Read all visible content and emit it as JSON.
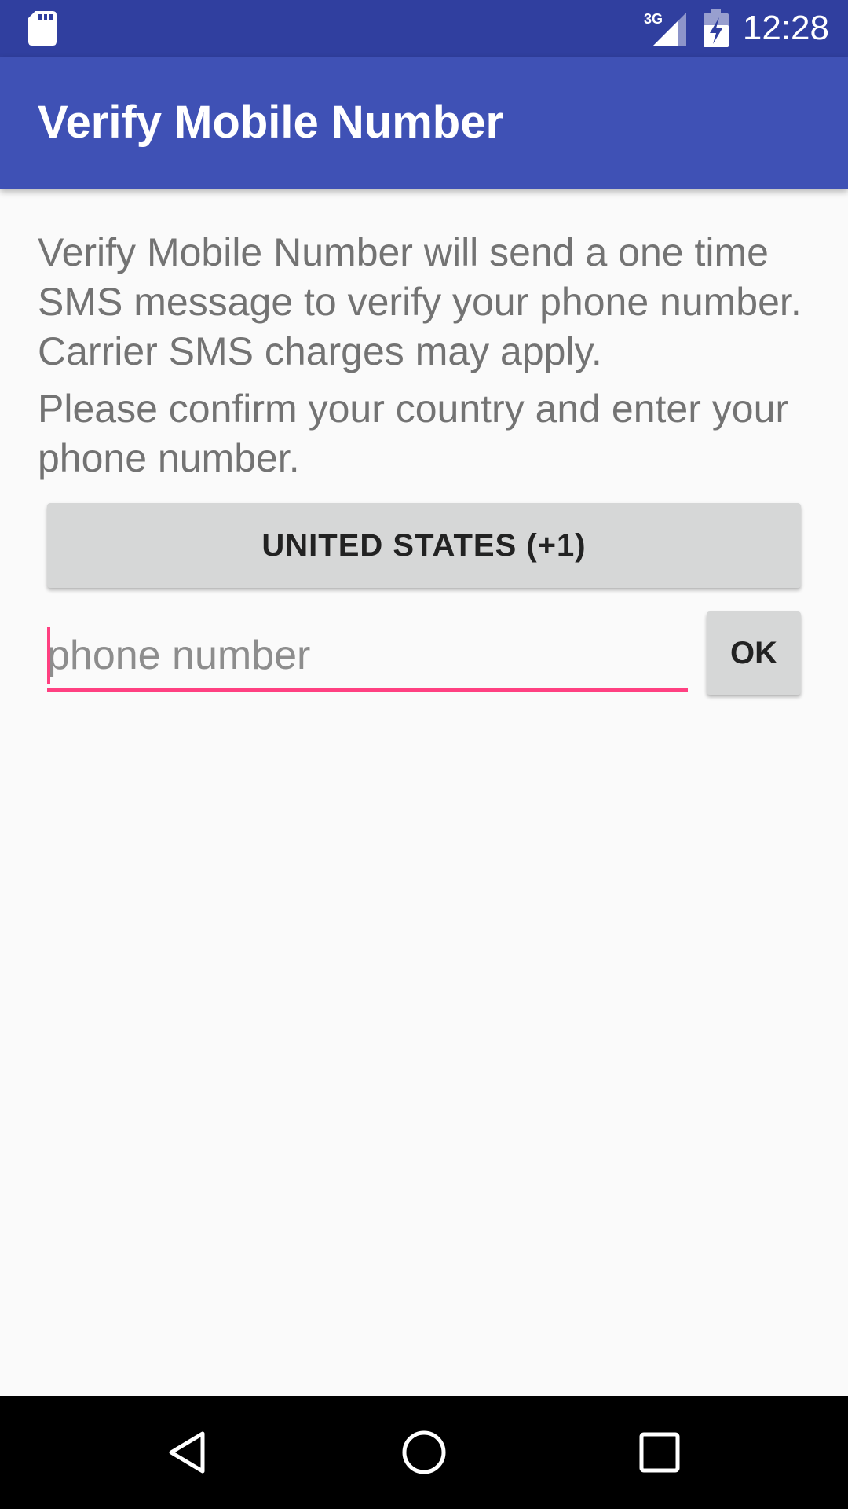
{
  "status_bar": {
    "network": "3G",
    "time": "12:28",
    "icons": [
      "sd-card-icon",
      "signal-icon",
      "battery-charging-icon"
    ]
  },
  "app_bar": {
    "title": "Verify Mobile Number"
  },
  "main": {
    "description": "Verify Mobile Number will send a one time SMS message to verify your phone number. Carrier SMS charges may apply.",
    "instructions": "Please confirm your country and enter your phone number.",
    "country_button_label": "UNITED STATES (+1)",
    "phone_input": {
      "value": "",
      "placeholder": "phone number"
    },
    "ok_label": "OK"
  },
  "nav_bar": {
    "icons": [
      "back-icon",
      "home-icon",
      "recents-icon"
    ]
  },
  "colors": {
    "status_bar": "#303f9f",
    "app_bar": "#3f51b5",
    "accent": "#ff4081",
    "background": "#fafafa",
    "button": "#d6d7d7",
    "nav_bar": "#000000"
  }
}
